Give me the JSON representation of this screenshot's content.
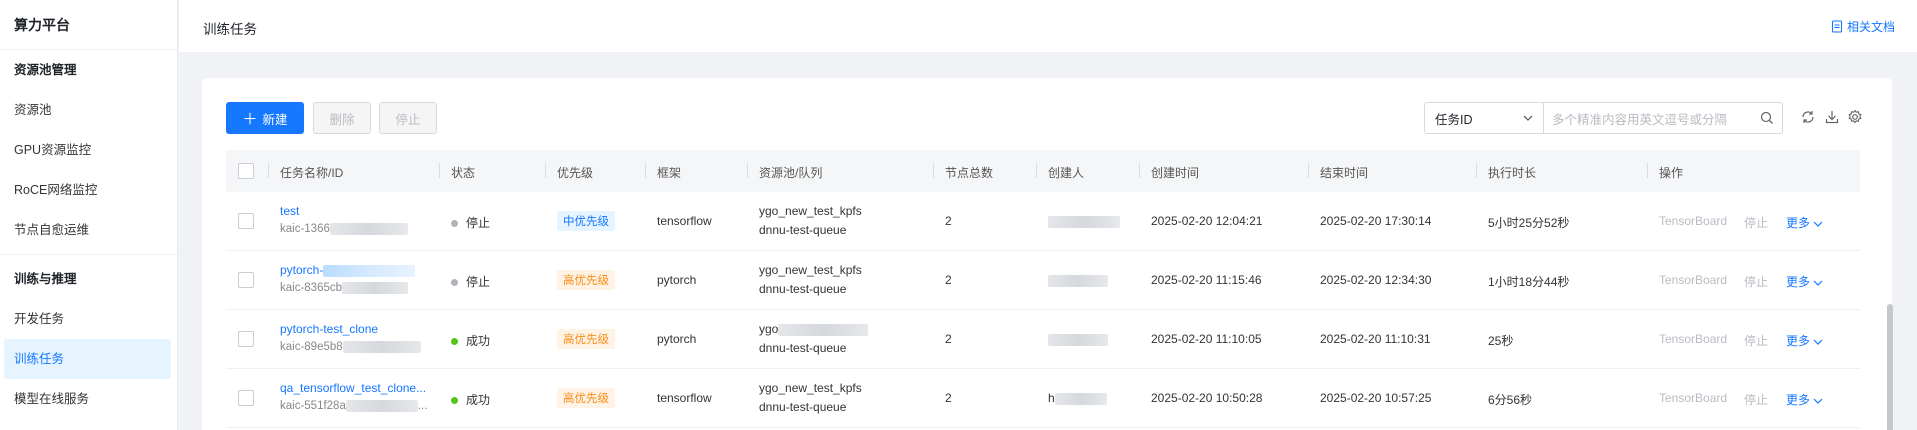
{
  "sidebar": {
    "brand": "算力平台",
    "groups": [
      {
        "title": "资源池管理",
        "items": [
          "资源池",
          "GPU资源监控",
          "RoCE网络监控",
          "节点自愈运维"
        ]
      },
      {
        "title": "训练与推理",
        "items": [
          "开发任务",
          "训练任务",
          "模型在线服务"
        ]
      }
    ],
    "active": "训练任务"
  },
  "header": {
    "title": "训练任务",
    "doc_link": "相关文档"
  },
  "toolbar": {
    "new_label": "新建",
    "delete_label": "删除",
    "stop_label": "停止",
    "filter_select": "任务ID",
    "search_placeholder": "多个精准内容用英文逗号或分隔"
  },
  "columns": [
    "任务名称/ID",
    "状态",
    "优先级",
    "框架",
    "资源池/队列",
    "节点总数",
    "创建人",
    "创建时间",
    "结束时间",
    "执行时长",
    "操作"
  ],
  "rows": [
    {
      "name": "test",
      "id": "kaic-1366",
      "status": "停止",
      "priority": "中优先级",
      "framework": "tensorflow",
      "pool": "ygo_new_test_kpfs",
      "queue": "dnnu-test-queue",
      "nodes": "2",
      "creator": "",
      "created": "2025-02-20 12:04:21",
      "ended": "2025-02-20 17:30:14",
      "duration": "5小时25分52秒"
    },
    {
      "name": "pytorch-",
      "id": "kaic-8365cb",
      "status": "停止",
      "priority": "高优先级",
      "framework": "pytorch",
      "pool": "ygo_new_test_kpfs",
      "queue": "dnnu-test-queue",
      "nodes": "2",
      "creator": "",
      "created": "2025-02-20 11:15:46",
      "ended": "2025-02-20 12:34:30",
      "duration": "1小时18分44秒"
    },
    {
      "name": "pytorch-test_clone",
      "id": "kaic-89e5b8",
      "status": "成功",
      "priority": "高优先级",
      "framework": "pytorch",
      "pool": "ygo",
      "queue": "dnnu-test-queue",
      "nodes": "2",
      "creator": "",
      "created": "2025-02-20 11:10:05",
      "ended": "2025-02-20 11:10:31",
      "duration": "25秒"
    },
    {
      "name": "qa_tensorflow_test_clone...",
      "id": "kaic-551f28a",
      "status": "成功",
      "priority": "高优先级",
      "framework": "tensorflow",
      "pool": "ygo_new_test_kpfs",
      "queue": "dnnu-test-queue",
      "nodes": "2",
      "creator": "h",
      "created": "2025-02-20 10:50:28",
      "ended": "2025-02-20 10:57:25",
      "duration": "6分56秒"
    }
  ],
  "actions": {
    "tensorboard": "TensorBoard",
    "stop": "停止",
    "more": "更多"
  },
  "colors": {
    "primary": "#1677ff",
    "stopped": "#b0b4ba",
    "success": "#52c41a",
    "high": "#fa8c16"
  }
}
